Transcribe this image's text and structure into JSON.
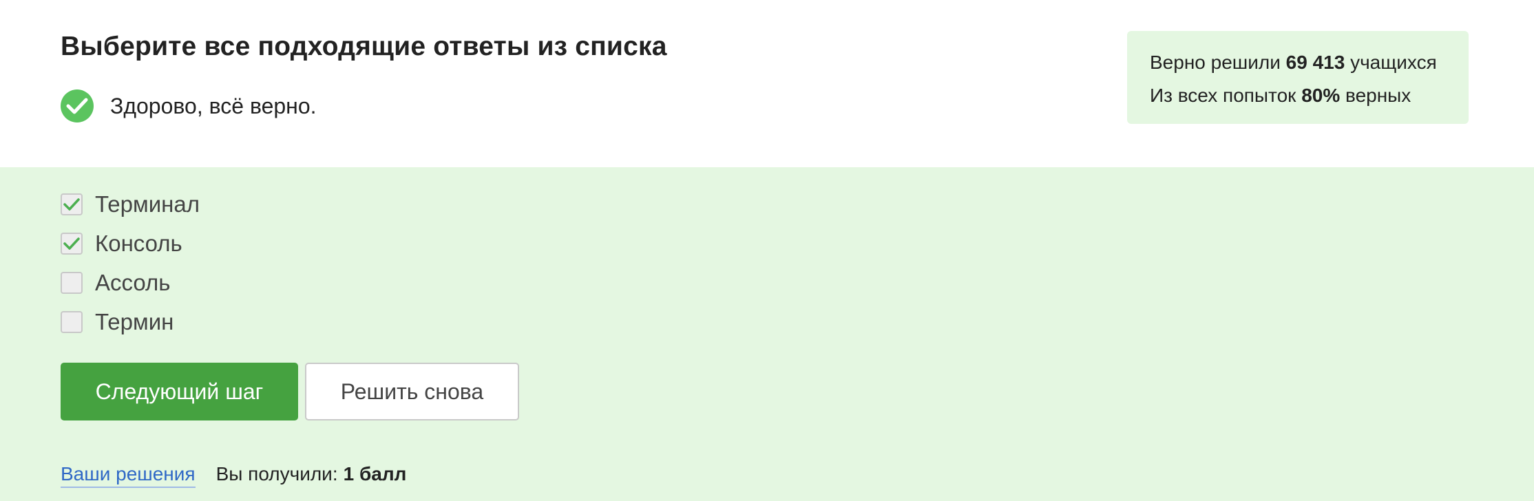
{
  "question": {
    "title": "Выберите все подходящие ответы из списка",
    "feedback": "Здорово, всё верно.",
    "feedback_icon": "check-circle-icon",
    "success_color": "#5bc45f"
  },
  "stats": {
    "solved_prefix": "Верно решили",
    "solved_count": "69 413",
    "solved_suffix": "учащихся",
    "attempts_prefix": "Из всех попыток",
    "attempts_percent": "80%",
    "attempts_suffix": "верных",
    "background_color": "#e4f7e1"
  },
  "options": [
    {
      "label": "Терминал",
      "checked": true
    },
    {
      "label": "Консоль",
      "checked": true
    },
    {
      "label": "Ассоль",
      "checked": false
    },
    {
      "label": "Термин",
      "checked": false
    }
  ],
  "buttons": {
    "next_label": "Следующий шаг",
    "retry_label": "Решить снова",
    "primary_color": "#45a240"
  },
  "footer": {
    "solutions_link": "Ваши решения",
    "score_label": "Вы получили:",
    "score_value": "1 балл",
    "link_color": "#2f68c6"
  }
}
